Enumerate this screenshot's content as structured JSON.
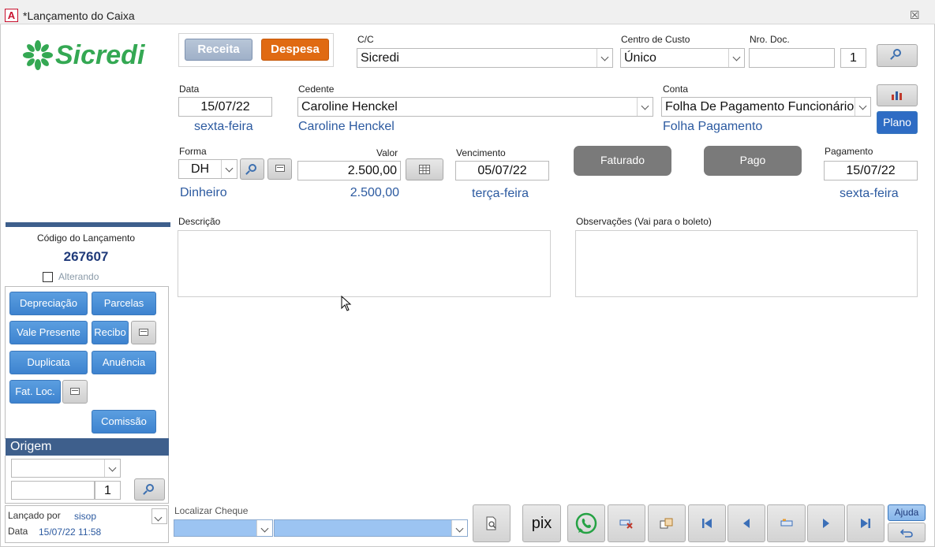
{
  "window": {
    "title": "*Lançamento do Caixa",
    "close": "☒"
  },
  "brand": {
    "name": "Sicredi",
    "color": "#34a853"
  },
  "type_buttons": {
    "receita": "Receita",
    "despesa": "Despesa"
  },
  "cc": {
    "label": "C/C",
    "value": "Sicredi"
  },
  "centro_custo": {
    "label": "Centro de Custo",
    "value": "Único"
  },
  "nro_doc": {
    "label": "Nro. Doc.",
    "value": "",
    "seq": "1"
  },
  "data": {
    "label": "Data",
    "value": "15/07/22",
    "weekday": "sexta-feira"
  },
  "cedente": {
    "label": "Cedente",
    "value": "Caroline Henckel",
    "display": "Caroline Henckel"
  },
  "conta": {
    "label": "Conta",
    "value": "Folha De Pagamento Funcionário",
    "display": "Folha Pagamento"
  },
  "plano_button": "Plano",
  "forma": {
    "label": "Forma",
    "value": "DH",
    "display": "Dinheiro"
  },
  "valor": {
    "label": "Valor",
    "value": "2.500,00",
    "display": "2.500,00"
  },
  "vencimento": {
    "label": "Vencimento",
    "value": "05/07/22",
    "weekday": "terça-feira"
  },
  "status_buttons": {
    "faturado": "Faturado",
    "pago": "Pago"
  },
  "pagamento": {
    "label": "Pagamento",
    "value": "15/07/22",
    "weekday": "sexta-feira"
  },
  "descricao": {
    "label": "Descrição",
    "value": ""
  },
  "observacoes": {
    "label": "Observações (Vai para o boleto)",
    "value": ""
  },
  "lancamento": {
    "label": "Código do Lançamento",
    "code": "267607",
    "alterando": "Alterando"
  },
  "side_buttons": {
    "depreciacao": "Depreciação",
    "parcelas": "Parcelas",
    "vale_presente": "Vale Presente",
    "recibo": "Recibo",
    "duplicata": "Duplicata",
    "anuencia": "Anuência",
    "fat_loc": "Fat. Loc.",
    "comissao": "Comissão"
  },
  "origem": {
    "label": "Origem",
    "select": "",
    "text": "",
    "seq": "1"
  },
  "audit": {
    "lancado_por_label": "Lançado por",
    "lancado_por": "sisop",
    "data_label": "Data",
    "data": "15/07/22 11:58"
  },
  "localizar": {
    "label": "Localizar Cheque",
    "left": "",
    "right": ""
  },
  "bottom": {
    "pix": "pix",
    "ajuda": "Ajuda"
  }
}
